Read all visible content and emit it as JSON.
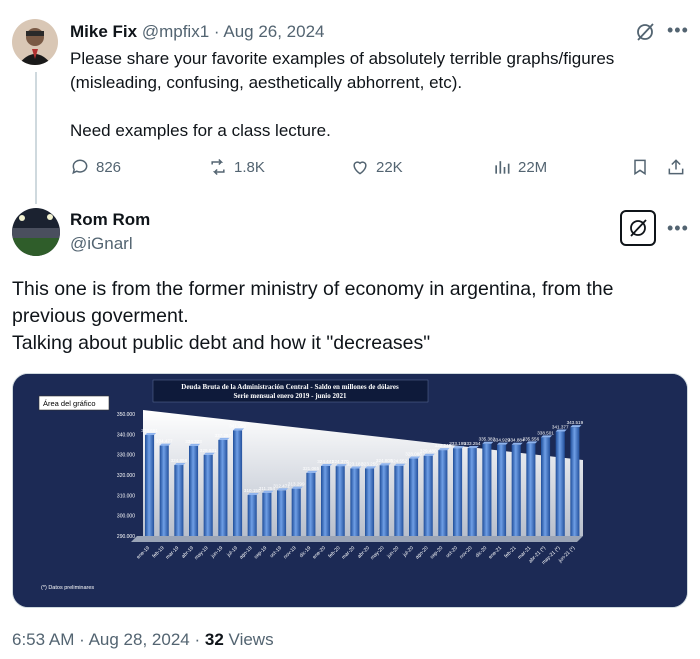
{
  "tweet1": {
    "name": "Mike Fix",
    "handle": "@mpfix1",
    "separator": "·",
    "date": "Aug 26, 2024",
    "paragraphs": [
      "Please share your favorite examples of absolutely terrible graphs/figures (misleading, confusing, aesthetically abhorrent, etc).",
      "Need examples for a class lecture."
    ],
    "actions": {
      "replies": "826",
      "reposts": "1.8K",
      "likes": "22K",
      "views": "22M"
    }
  },
  "tweet2": {
    "name": "Rom Rom",
    "handle": "@iGnarl",
    "lines": [
      "This one is from the former ministry of economy in argentina, from the",
      "previous goverment.",
      "Talking about public debt and how it \"decreases\""
    ],
    "time": "6:53 AM",
    "separator": "·",
    "date": "Aug 28, 2024",
    "views_count": "32",
    "views_label": "Views"
  },
  "icons": [
    "reply-icon",
    "repost-icon",
    "like-icon",
    "views-icon",
    "bookmark-icon",
    "share-icon",
    "grok-icon",
    "more-icon"
  ],
  "colors": {
    "text": "#0f1419",
    "muted": "#536471",
    "chart_bg": "#1c2a55",
    "bar": "#3f73c6"
  },
  "chart_data": {
    "type": "bar",
    "title": "Deuda Bruta de la Administración Central - Saldo en millones de dólares",
    "subtitle": "Serie mensual enero 2019 - junio 2021",
    "area_label": "Área del gráfico",
    "footnote": "(*) Datos preliminares",
    "ylim": [
      290000,
      350000
    ],
    "yticks": [
      "350.000",
      "340.000",
      "330.000",
      "320.000",
      "310.000",
      "300.000",
      "290.000"
    ],
    "categories": [
      "ene-19",
      "feb-19",
      "mar-19",
      "abr-19",
      "may-19",
      "jun-19",
      "jul-19",
      "ago-19",
      "sep-19",
      "oct-19",
      "nov-19",
      "dic-19",
      "ene-20",
      "feb-20",
      "mar-20",
      "abr-20",
      "may-20",
      "jun-20",
      "jul-20",
      "ago-20",
      "sep-20",
      "oct-20",
      "nov-20",
      "dic-20",
      "ene-21",
      "feb-21",
      "mar-21",
      "abr-21 (*)",
      "may-21 (*)",
      "jun-21 (*)"
    ],
    "values": [
      339661,
      334477,
      324898,
      334323,
      329931,
      337267,
      341958,
      310150,
      311254,
      312471,
      313299,
      321065,
      324441,
      324370,
      323181,
      323255,
      324808,
      324552,
      328088,
      329480,
      332248,
      333195,
      333254,
      335382,
      334929,
      334884,
      335556,
      338501,
      341377,
      343519
    ],
    "labels": [
      "339.661",
      "334.477",
      "324.898",
      "334.323",
      "329.931",
      "337.267",
      "341.958",
      "310.150",
      "311.254",
      "312.471",
      "313.299",
      "321.065",
      "324.441",
      "324.370",
      "323.181",
      "323.255",
      "324.808",
      "324.552",
      "328.088",
      "329.480",
      "332.248",
      "333.195",
      "333.254",
      "335.382",
      "334.929",
      "334.884",
      "335.556",
      "338.501",
      "341.377",
      "343.519"
    ]
  }
}
